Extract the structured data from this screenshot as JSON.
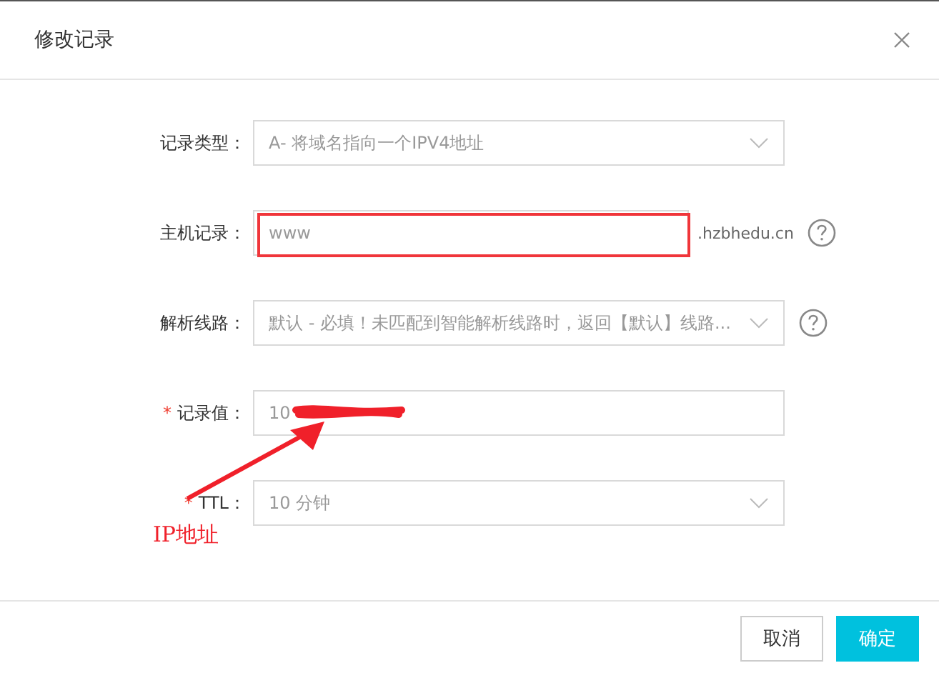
{
  "dialog": {
    "title": "修改记录"
  },
  "fields": [
    {
      "kind": "select",
      "label": "记录类型：",
      "value": "A- 将域名指向一个IPV4地址",
      "help": false,
      "highlighted": false,
      "redacted": false
    },
    {
      "kind": "input",
      "label": "主机记录：",
      "value": "www",
      "suffix": ".hzbhedu.cn",
      "help": true,
      "highlighted": true,
      "redacted": false
    },
    {
      "kind": "select",
      "label": "解析线路：",
      "value": "默认 - 必填！未匹配到智能解析线路时，返回【默认】线路...",
      "help": true,
      "highlighted": false,
      "redacted": false
    },
    {
      "kind": "input",
      "label": "记录值：",
      "required_mark": "*",
      "value": "10",
      "help": false,
      "highlighted": false,
      "redacted": true
    },
    {
      "kind": "select",
      "label": "TTL：",
      "required_mark": "*",
      "value": "10 分钟",
      "help": false,
      "highlighted": false,
      "redacted": false
    }
  ],
  "annotation": {
    "text": "IP地址"
  },
  "buttons": [
    {
      "label": "取消",
      "kind": "secondary"
    },
    {
      "label": "确定",
      "kind": "primary"
    }
  ]
}
